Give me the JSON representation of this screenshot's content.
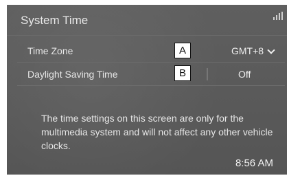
{
  "header": {
    "title": "System Time"
  },
  "settings": [
    {
      "label": "Time Zone",
      "value": "GMT+8",
      "callout": "A"
    },
    {
      "label": "Daylight Saving Time",
      "value": "Off",
      "callout": "B"
    }
  ],
  "note": "The time settings on this screen are only for the multimedia system and will not affect any other vehicle clocks.",
  "status": {
    "clock": "8:56 AM"
  }
}
